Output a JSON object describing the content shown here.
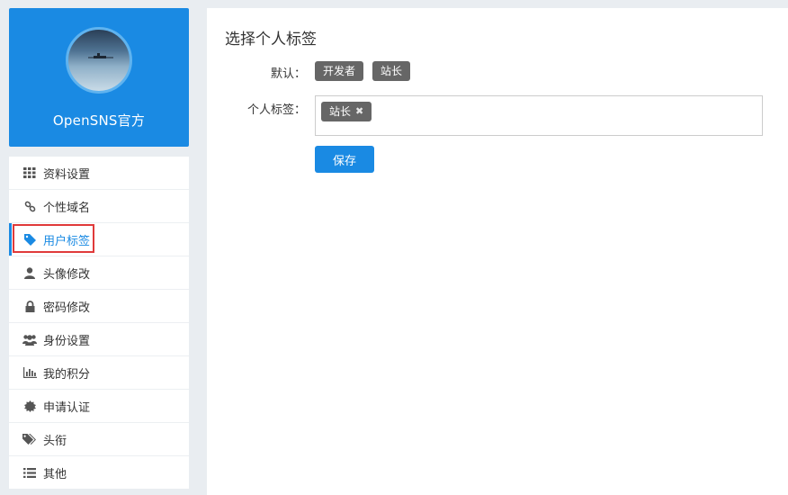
{
  "profile": {
    "site_name": "OpenSNS官方"
  },
  "menu": {
    "items": [
      {
        "label": "资料设置",
        "icon": "grid-icon"
      },
      {
        "label": "个性域名",
        "icon": "link-icon"
      },
      {
        "label": "用户标签",
        "icon": "tag-icon"
      },
      {
        "label": "头像修改",
        "icon": "user-icon"
      },
      {
        "label": "密码修改",
        "icon": "lock-icon"
      },
      {
        "label": "身份设置",
        "icon": "users-icon"
      },
      {
        "label": "我的积分",
        "icon": "bar-chart-icon"
      },
      {
        "label": "申请认证",
        "icon": "certificate-icon"
      },
      {
        "label": "头衔",
        "icon": "tags-icon"
      },
      {
        "label": "其他",
        "icon": "list-icon"
      }
    ],
    "active_index": 2
  },
  "main": {
    "title": "选择个人标签",
    "default_label": "默认：",
    "default_tags": [
      "开发者",
      "站长"
    ],
    "personal_label": "个人标签：",
    "selected_tags": [
      "站长"
    ],
    "save_label": "保存"
  },
  "colors": {
    "accent": "#1a8ae3",
    "tag_bg": "#666666",
    "highlight": "#e03a3a"
  }
}
